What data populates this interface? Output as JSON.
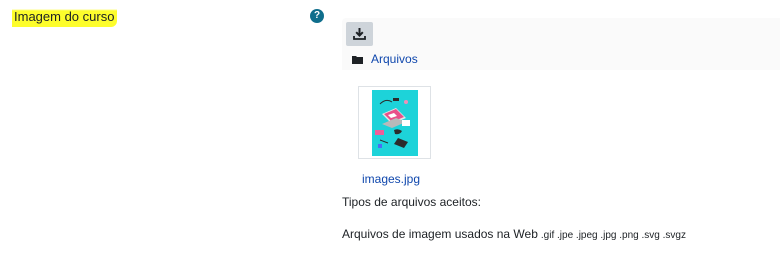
{
  "field": {
    "label": "Imagem do curso",
    "help_icon": "question-circle-icon",
    "help_glyph": "?"
  },
  "filemanager": {
    "download_icon": "download-icon",
    "breadcrumb_icon": "folder-icon",
    "breadcrumb_label": "Arquivos",
    "files": [
      {
        "name": "images.jpg",
        "thumbnail": "isometric-laptop-illustration"
      }
    ]
  },
  "accepted_types": {
    "heading": "Tipos de arquivos aceitos:",
    "description": "Arquivos de imagem usados na Web",
    "extensions": ".gif .jpe .jpeg .jpg .png .svg .svgz"
  },
  "colors": {
    "highlight": "#fdfd2c",
    "help": "#0f6e8c",
    "link": "#0f47ad",
    "thumbnail_bg": "#1dd3d9"
  }
}
